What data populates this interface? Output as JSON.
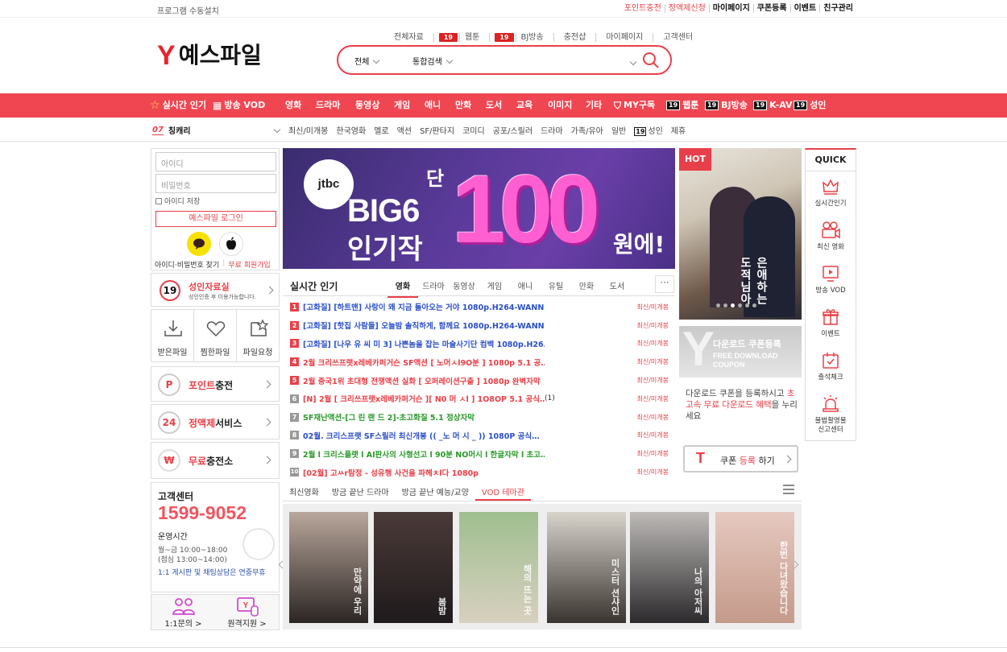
{
  "topbar": {
    "install": "프로그램 수동설치",
    "links": [
      {
        "label": "포인트충전",
        "style": "red"
      },
      {
        "label": "정액제신청",
        "style": "red"
      },
      {
        "label": "마이페이지",
        "style": "dark"
      },
      {
        "label": "쿠폰등록",
        "style": "dark"
      },
      {
        "label": "이벤트",
        "style": "dark"
      },
      {
        "label": "친구관리",
        "style": "dark"
      }
    ]
  },
  "header": {
    "logo_mark": "Y",
    "logo_text": "예스파일",
    "subnav": [
      "전체자료",
      "웹툰",
      "BJ방송",
      "충전샵",
      "마이페이지",
      "고객센터"
    ],
    "subnav_badge": "19",
    "search": {
      "scope": "전체",
      "type": "통합검색",
      "placeholder": ""
    }
  },
  "rednav": {
    "items": [
      "실시간 인기",
      "방송 VOD",
      "영화",
      "드라마",
      "동영상",
      "게임",
      "애니",
      "만화",
      "도서",
      "교육",
      "이미지",
      "기타",
      "MY구독",
      "웹툰",
      "BJ방송",
      "K-AV",
      "성인"
    ],
    "badge": "19"
  },
  "genre": {
    "current_num": "07",
    "current_label": "칭캐리",
    "links": [
      "최신/미개봉",
      "한국영화",
      "멜로",
      "액션",
      "SF/판타지",
      "코미디",
      "공포/스릴러",
      "드라마",
      "가족/유아",
      "일반",
      "성인",
      "제휴"
    ],
    "badge": "19"
  },
  "login": {
    "id_placeholder": "아이디",
    "pw_placeholder": "비밀번호",
    "save_id": "아이디 저장",
    "login_button": "예스파일 로그인",
    "find": "아이디·비밀번호 찾기",
    "join": "무료 회원가입"
  },
  "adult": {
    "badge": "19",
    "title": "성인자료실",
    "desc": "성인인증 후 이용가능합니다."
  },
  "quick3": [
    "받은파일",
    "찜한파일",
    "파일요청"
  ],
  "services": [
    {
      "icon": "P",
      "red": "포인트",
      "rest": "충전"
    },
    {
      "icon": "24",
      "red": "정액제",
      "rest": "서비스"
    },
    {
      "icon": "₩",
      "red": "무료",
      "rest": "충전소"
    }
  ],
  "cs": {
    "title": "고객센터",
    "phone": "1599-9052",
    "hours_title": "운영시간",
    "hours1": "월~금 10:00~18:00",
    "hours2": "(점심 13:00~14:00)",
    "note": "1:1 게시판 및 채팅상담은 연중무휴"
  },
  "help": [
    "1:1문의 >",
    "원격지원 >"
  ],
  "banner": {
    "logo": "jtbc",
    "big6": "BIG6",
    "ingi": "인기작",
    "dan": "단",
    "num": "100",
    "won": "원에!"
  },
  "realtime": {
    "title": "실시간 인기",
    "tabs": [
      "영화",
      "드라마",
      "동영상",
      "게임",
      "애니",
      "유틸",
      "만화",
      "도서"
    ],
    "more": "···",
    "items": [
      {
        "n": "1",
        "title": "[고화질] [하트맨] 사랑이 왜 지금 돌아오는 거야 1080p.H264-WANN…",
        "count": "",
        "cat": "최신/미개봉",
        "color": "#2b50c8",
        "nbg": "#e84048"
      },
      {
        "n": "2",
        "title": "[고화질] [핫집 사람들] 오늘밤 솔직하게, 함께요 1080p.H264-WANN…",
        "count": "",
        "cat": "최신/미개봉",
        "color": "#2b50c8",
        "nbg": "#e84048"
      },
      {
        "n": "3",
        "title": "[고화질] [나우 유 씨 미 3] 나쁜놈을 잡는 마술사기단 컴백 1080p.H26…",
        "count": "",
        "cat": "최신/미개봉",
        "color": "#2b50c8",
        "nbg": "#e84048"
      },
      {
        "n": "4",
        "title": "2월 크리쓰프랫x레베카퍼거슨 SF액션 [ 노머ㅅl9O분 ] 1080p 5.1 공…",
        "count": "",
        "cat": "최신/미개봉",
        "color": "#e84048",
        "nbg": "#e84048"
      },
      {
        "n": "5",
        "title": "2월 중국1위 초대형 전쟁액션 실화 [ 오퍼레이션구출 ] 1080p 완벽자막",
        "count": "",
        "cat": "최신/미개봉",
        "color": "#e84048",
        "nbg": "#e84048"
      },
      {
        "n": "6",
        "title": "[N] 2월 [ 크리쓰프랫x레베카퍼거슨 ][ N0 머 ㅅl ] 1O8OP 5.1 공식…",
        "count": "(1)",
        "cat": "최신/미개봉",
        "color": "#e84048",
        "nbg": "#999"
      },
      {
        "n": "7",
        "title": "SF재난액션-[그 린 랜 드 2]-초고화질 5.1 정상자막",
        "count": "",
        "cat": "최신/미개봉",
        "color": "#2a9a2a",
        "nbg": "#999"
      },
      {
        "n": "8",
        "title": "02월. 크리스프랫 SF스릴러 최신개봉 (( _노 머 시 _ )) 1080P 공식…",
        "count": "",
        "cat": "최신/미개봉",
        "color": "#2b50c8",
        "nbg": "#999"
      },
      {
        "n": "9",
        "title": "2월 l 크리스플랫 l AI판사의 사형선고 l 90분 NO머시 l 한글자막 l 초고…",
        "count": "",
        "cat": "최신/미개봉",
        "color": "#2a9a2a",
        "nbg": "#999"
      },
      {
        "n": "10",
        "title": "[02월] 고ㅆr탐정 - 성유행 사건을 파헤ㅊl다 1080p",
        "count": "",
        "cat": "최신/미개봉",
        "color": "#e84048",
        "nbg": "#999"
      }
    ]
  },
  "vod": {
    "tabs": [
      "최신영화",
      "방금 끝난 드라마",
      "방금 끝난 예능/교양",
      "VOD 테마관"
    ],
    "active": 3,
    "posters": [
      {
        "title": "만약에 우리",
        "c1": "#b9a79c",
        "c2": "#2b2523"
      },
      {
        "title": "봄밤",
        "c1": "#4a3a38",
        "c2": "#1f1a1c"
      },
      {
        "title": "해의 뜨는 곳",
        "c1": "#9fbf8f",
        "c2": "#d8d0c0"
      },
      {
        "title": "미스터 션샤인",
        "c1": "#d8d4cc",
        "c2": "#3a3430"
      },
      {
        "title": "나의 아저씨",
        "c1": "#bdbab8",
        "c2": "#2c2a2c"
      },
      {
        "title": "한번 다녀왔습니다",
        "c1": "#e6c9c0",
        "c2": "#c49a8a"
      }
    ]
  },
  "hot": {
    "badge": "HOT",
    "title": "은애하는 도적님아"
  },
  "coupon": {
    "mark": "Y",
    "line1": "다운로드 쿠폰등록",
    "line2": "FREE DOWNLOAD",
    "line3": "COUPON",
    "desc_a": "다운로드 쿠폰을 등록하시고 ",
    "desc_red": "초고속 무료 다운로드 혜택",
    "desc_b": "을 누리세요",
    "btn_icon": "T",
    "btn_a": "쿠폰 ",
    "btn_red": "등록",
    "btn_b": " 하기"
  },
  "quick": {
    "title": "QUICK",
    "items": [
      "실시간인기",
      "최신 영화",
      "방송 VOD",
      "이벤트",
      "출석체크",
      "불법촬영물\n신고센터"
    ]
  }
}
